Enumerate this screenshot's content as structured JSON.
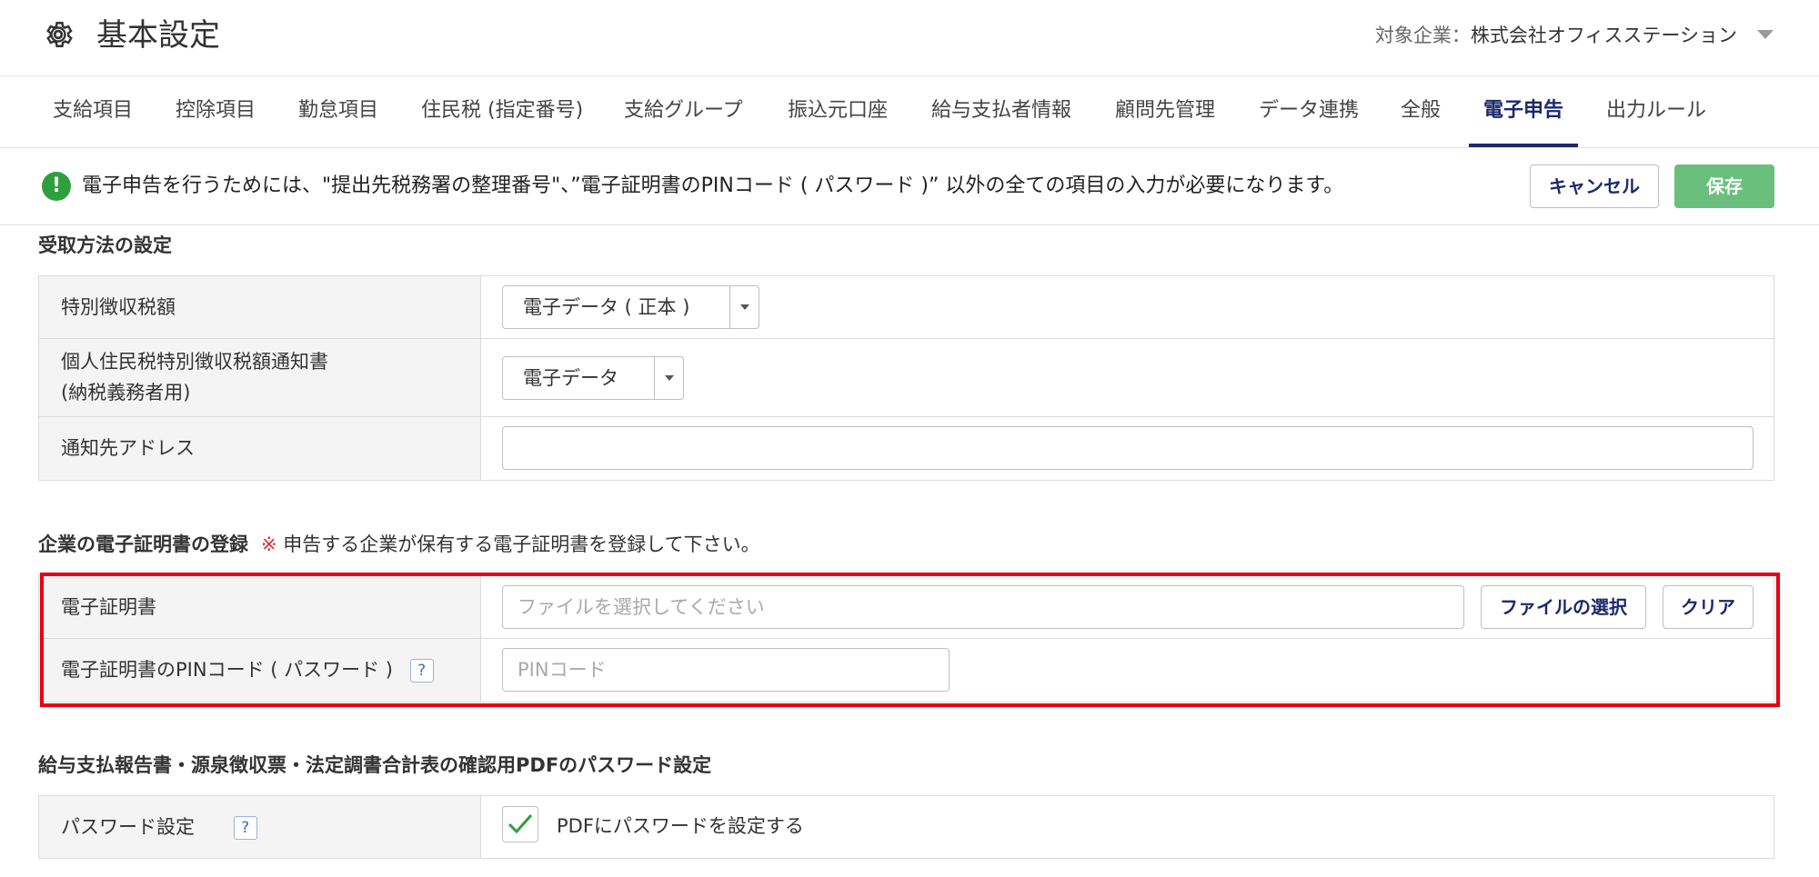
{
  "header": {
    "title": "基本設定",
    "company_label": "対象企業：",
    "company_name": "株式会社オフィスステーション"
  },
  "tabs": [
    {
      "label": "支給項目"
    },
    {
      "label": "控除項目"
    },
    {
      "label": "勤怠項目"
    },
    {
      "label": "住民税 (指定番号)"
    },
    {
      "label": "支給グループ"
    },
    {
      "label": "振込元口座"
    },
    {
      "label": "給与支払者情報"
    },
    {
      "label": "顧問先管理"
    },
    {
      "label": "データ連携"
    },
    {
      "label": "全般"
    },
    {
      "label": "電子申告",
      "active": true
    },
    {
      "label": "出力ルール"
    }
  ],
  "notice": {
    "message": "電子申告を行うためには、\"提出先税務署の整理番号\"、”電子証明書のPINコード ( パスワード )” 以外の全ての項目の入力が必要になります。",
    "cancel_label": "キャンセル",
    "save_label": "保存"
  },
  "receive_section": {
    "title": "受取方法の設定",
    "rows": [
      {
        "label": "特別徴収税額",
        "value": "電子データ ( 正本 )"
      },
      {
        "label_line1": "個人住民税特別徴収税額通知書",
        "label_line2": "(納税義務者用)",
        "value": "電子データ"
      },
      {
        "label": "通知先アドレス",
        "value": ""
      }
    ]
  },
  "cert_section": {
    "title": "企業の電子証明書の登録",
    "note_mark": "※",
    "note": "申告する企業が保有する電子証明書を登録して下さい。",
    "cert_label": "電子証明書",
    "file_placeholder": "ファイルを選択してください",
    "file_button": "ファイルの選択",
    "clear_button": "クリア",
    "pin_label": "電子証明書のPINコード ( パスワード )",
    "pin_placeholder": "PINコード",
    "help": "?"
  },
  "pdf_section": {
    "title": "給与支払報告書・源泉徴収票・法定調書合計表の確認用PDFのパスワード設定",
    "password_label": "パスワード設定",
    "help": "?",
    "checkbox_label": "PDFにパスワードを設定する",
    "checked": true
  },
  "colors": {
    "accent": "#1c2a6b",
    "save": "#6bbf7c",
    "highlight": "#e60012",
    "notice_icon": "#2e9e3f"
  }
}
